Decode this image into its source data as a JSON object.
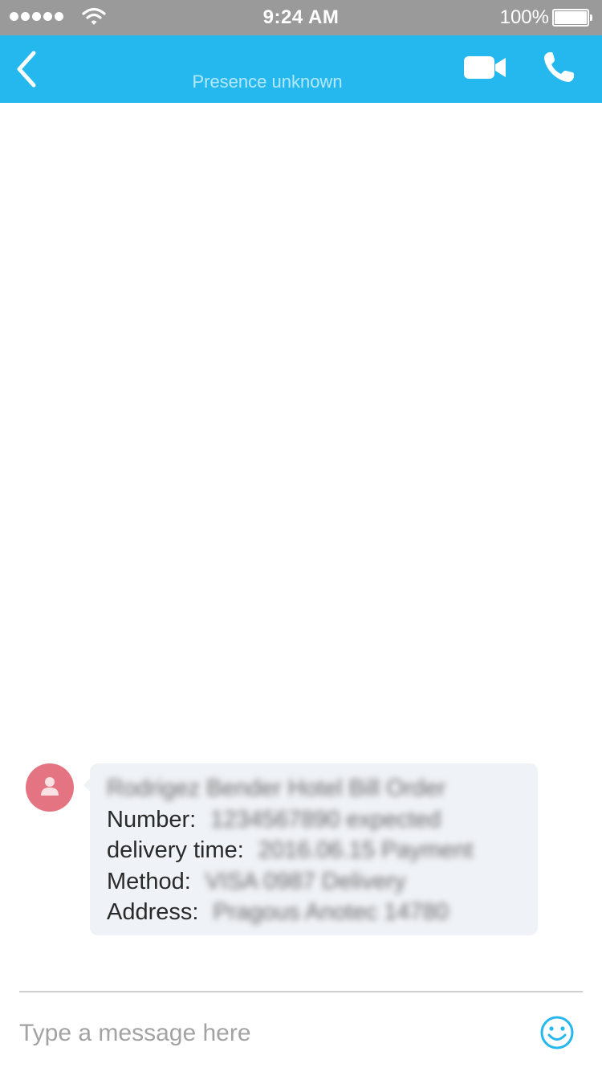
{
  "status_bar": {
    "time": "9:24 AM",
    "battery_percent": "100%",
    "signal_icon": "signal-dots-icon",
    "wifi_icon": "wifi-icon",
    "battery_icon": "battery-icon"
  },
  "nav": {
    "presence": "Presence unknown",
    "back_icon": "chevron-left-icon",
    "video_icon": "video-camera-icon",
    "call_icon": "phone-icon",
    "background_color": "#25b8ef"
  },
  "message": {
    "avatar_icon": "person-icon",
    "avatar_color": "#e57482",
    "bubble_color": "#eff2f6",
    "lines": [
      {
        "label": "",
        "value": "Rodrigez Bender Hotel Bill Order"
      },
      {
        "label": "Number:",
        "value": "1234567890 expected"
      },
      {
        "label": "delivery time:",
        "value": "2016.06.15 Payment"
      },
      {
        "label": "Method:",
        "value": "VISA 0987 Delivery"
      },
      {
        "label": "Address:",
        "value": "Pragous Anotec 14780"
      }
    ]
  },
  "composer": {
    "placeholder": "Type a message here",
    "emoji_icon": "smiley-icon"
  }
}
